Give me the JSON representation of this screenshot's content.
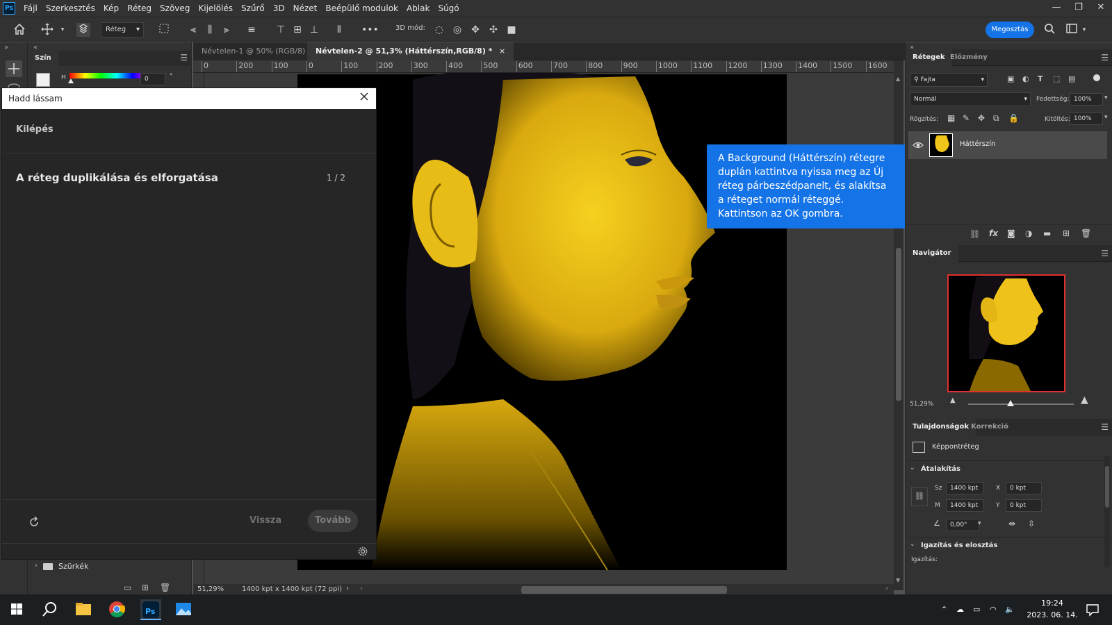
{
  "app": {
    "logo": "Ps"
  },
  "menu": [
    "Fájl",
    "Szerkesztés",
    "Kép",
    "Réteg",
    "Szöveg",
    "Kijelölés",
    "Szűrő",
    "3D",
    "Nézet",
    "Beépülő modulok",
    "Ablak",
    "Súgó"
  ],
  "window_controls": {
    "minimize": "—",
    "restore": "❐",
    "close": "✕"
  },
  "options": {
    "layer_select": "Réteg",
    "mode3d": "3D mód:",
    "share": "Megosztás"
  },
  "left_panel": {
    "tab": "Szín",
    "h_label": "H",
    "h_value": "0",
    "h_unit": "°",
    "folder": "Szürkék"
  },
  "documents": [
    {
      "label": "Névtelen-1 @ 50% (RGB/8)",
      "close": "×"
    },
    {
      "label": "Névtelen-2 @ 51,3% (Háttérszín,RGB/8) *",
      "close": "×"
    }
  ],
  "ruler_marks": [
    "0",
    "200",
    "100",
    "0",
    "100",
    "200",
    "300",
    "400",
    "500",
    "600",
    "700",
    "800",
    "900",
    "1000",
    "1100",
    "1200",
    "1300",
    "1400",
    "1500",
    "1600"
  ],
  "status": {
    "zoom": "51,29%",
    "doc_size": "1400 kpt x 1400 kpt (72 ppi)"
  },
  "learn": {
    "title": "Hadd lássam",
    "exit": "Kilépés",
    "step_title": "A réteg duplikálása és elforgatása",
    "step_count": "1 / 2",
    "back": "Vissza",
    "next": "Tovább"
  },
  "callout": "A Background (Háttérszín) rétegre duplán kattintva nyissa meg az Új réteg párbeszédpanelt, és alakítsa a réteget normál réteggé. Kattintson az OK gombra.",
  "layers": {
    "tabs": [
      "Rétegek",
      "Előzmény"
    ],
    "filter": "Fajta",
    "blend": "Normál",
    "opacity_label": "Fedettség:",
    "opacity": "100%",
    "lock_label": "Rögzítés:",
    "fill_label": "Kitöltés:",
    "fill": "100%",
    "layer_name": "Háttérszín"
  },
  "navigator": {
    "title": "Navigátor",
    "zoom": "51,29%"
  },
  "properties": {
    "tabs": [
      "Tulajdonságok",
      "Korrekció"
    ],
    "type": "Képpontréteg",
    "transform": "Átalakítás",
    "w_label": "Sz",
    "w_value": "1400 kpt",
    "h_label": "M",
    "h_value": "1400 kpt",
    "x_label": "X",
    "x_value": "0 kpt",
    "y_label": "Y",
    "y_value": "0 kpt",
    "angle": "0,00°",
    "align_section": "Igazítás és elosztás",
    "align_label": "Igazítás:"
  },
  "taskbar": {
    "time": "19:24",
    "date": "2023. 06. 14."
  },
  "colors": {
    "accent": "#1473e6",
    "paint": "#f0c419",
    "chrome": "#323232"
  }
}
